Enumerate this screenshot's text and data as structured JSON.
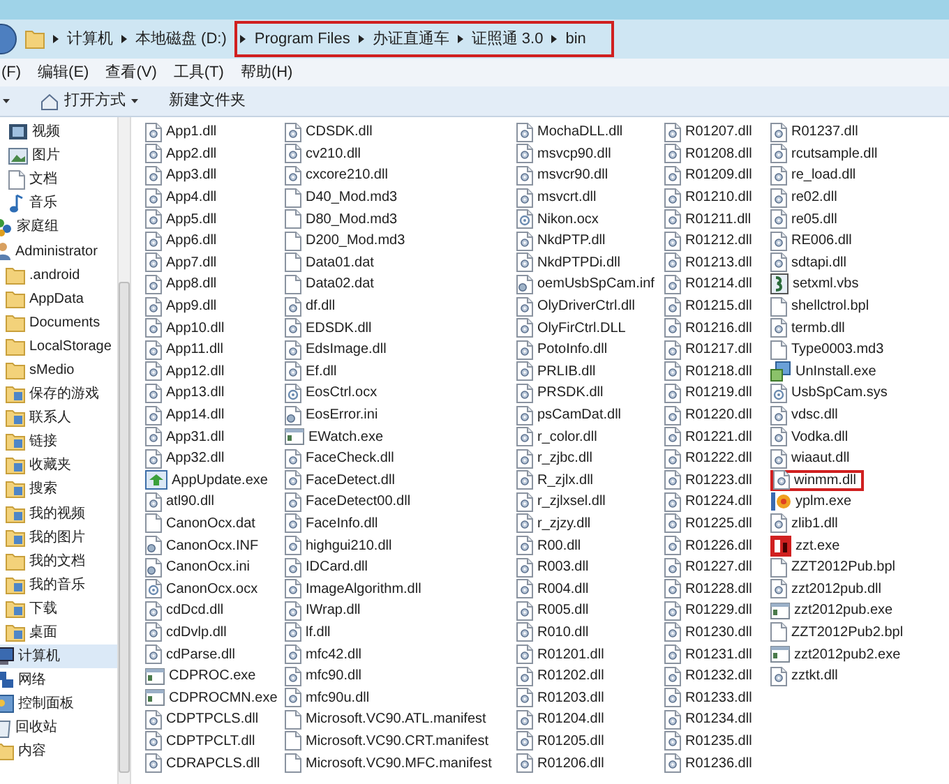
{
  "address": {
    "crumbs": [
      {
        "label": "计算机",
        "highlighted": false
      },
      {
        "label": "本地磁盘 (D:)",
        "highlighted": false
      },
      {
        "label": "Program Files",
        "highlighted": true
      },
      {
        "label": "办证直通车",
        "highlighted": true
      },
      {
        "label": "证照通 3.0",
        "highlighted": true
      },
      {
        "label": "bin",
        "highlighted": true
      }
    ]
  },
  "menu": [
    "(F)",
    "编辑(E)",
    "查看(V)",
    "工具(T)",
    "帮助(H)"
  ],
  "toolbar": [
    {
      "label": "打开方式",
      "kind": "open"
    },
    {
      "label": "新建文件夹",
      "kind": "plain"
    }
  ],
  "sidebar": {
    "library_items": [
      {
        "label": "视频",
        "kind": "video",
        "selected": false
      },
      {
        "label": "图片",
        "kind": "picture",
        "selected": false
      },
      {
        "label": "文档",
        "kind": "document",
        "selected": false
      },
      {
        "label": "音乐",
        "kind": "music",
        "selected": false
      }
    ],
    "items": [
      {
        "label": "家庭组",
        "kind": "homegroup",
        "selected": false
      },
      {
        "label": "Administrator",
        "kind": "user",
        "selected": false,
        "children": [
          {
            "label": ".android",
            "kind": "folder",
            "selected": false
          },
          {
            "label": "AppData",
            "kind": "folder",
            "selected": false
          },
          {
            "label": "Documents",
            "kind": "folder",
            "selected": false
          },
          {
            "label": "LocalStorage",
            "kind": "folder",
            "selected": false
          },
          {
            "label": "sMedio",
            "kind": "folder",
            "selected": false
          },
          {
            "label": "保存的游戏",
            "kind": "special",
            "selected": false
          },
          {
            "label": "联系人",
            "kind": "special",
            "selected": false
          },
          {
            "label": "链接",
            "kind": "special",
            "selected": false
          },
          {
            "label": "收藏夹",
            "kind": "special",
            "selected": false
          },
          {
            "label": "搜索",
            "kind": "special",
            "selected": false
          },
          {
            "label": "我的视频",
            "kind": "special",
            "selected": false
          },
          {
            "label": "我的图片",
            "kind": "special",
            "selected": false
          },
          {
            "label": "我的文档",
            "kind": "folder",
            "selected": false
          },
          {
            "label": "我的音乐",
            "kind": "special",
            "selected": false
          },
          {
            "label": "下载",
            "kind": "special",
            "selected": false
          },
          {
            "label": "桌面",
            "kind": "special",
            "selected": false
          }
        ]
      },
      {
        "label": "计算机",
        "kind": "computer",
        "selected": true
      },
      {
        "label": "网络",
        "kind": "network",
        "selected": false
      },
      {
        "label": "控制面板",
        "kind": "control",
        "selected": false
      },
      {
        "label": "回收站",
        "kind": "recycle",
        "selected": false
      },
      {
        "label": "内容",
        "kind": "folder",
        "selected": false
      }
    ]
  },
  "files": [
    {
      "name": "App1.dll",
      "kind": "dll",
      "highlighted": false
    },
    {
      "name": "App2.dll",
      "kind": "dll",
      "highlighted": false
    },
    {
      "name": "App3.dll",
      "kind": "dll",
      "highlighted": false
    },
    {
      "name": "App4.dll",
      "kind": "dll",
      "highlighted": false
    },
    {
      "name": "App5.dll",
      "kind": "dll",
      "highlighted": false
    },
    {
      "name": "App6.dll",
      "kind": "dll",
      "highlighted": false
    },
    {
      "name": "App7.dll",
      "kind": "dll",
      "highlighted": false
    },
    {
      "name": "App8.dll",
      "kind": "dll",
      "highlighted": false
    },
    {
      "name": "App9.dll",
      "kind": "dll",
      "highlighted": false
    },
    {
      "name": "App10.dll",
      "kind": "dll",
      "highlighted": false
    },
    {
      "name": "App11.dll",
      "kind": "dll",
      "highlighted": false
    },
    {
      "name": "App12.dll",
      "kind": "dll",
      "highlighted": false
    },
    {
      "name": "App13.dll",
      "kind": "dll",
      "highlighted": false
    },
    {
      "name": "App14.dll",
      "kind": "dll",
      "highlighted": false
    },
    {
      "name": "App31.dll",
      "kind": "dll",
      "highlighted": false
    },
    {
      "name": "App32.dll",
      "kind": "dll",
      "highlighted": false
    },
    {
      "name": "AppUpdate.exe",
      "kind": "update",
      "highlighted": false
    },
    {
      "name": "atl90.dll",
      "kind": "dll",
      "highlighted": false
    },
    {
      "name": "CanonOcx.dat",
      "kind": "file",
      "highlighted": false
    },
    {
      "name": "CanonOcx.INF",
      "kind": "config",
      "highlighted": false
    },
    {
      "name": "CanonOcx.ini",
      "kind": "config",
      "highlighted": false
    },
    {
      "name": "CanonOcx.ocx",
      "kind": "ocx",
      "highlighted": false
    },
    {
      "name": "cdDcd.dll",
      "kind": "dll",
      "highlighted": false
    },
    {
      "name": "cdDvlp.dll",
      "kind": "dll",
      "highlighted": false
    },
    {
      "name": "cdParse.dll",
      "kind": "dll",
      "highlighted": false
    },
    {
      "name": "CDPROC.exe",
      "kind": "exe",
      "highlighted": false
    },
    {
      "name": "CDPROCMN.exe",
      "kind": "exe",
      "highlighted": false
    },
    {
      "name": "CDPTPCLS.dll",
      "kind": "dll",
      "highlighted": false
    },
    {
      "name": "CDPTPCLT.dll",
      "kind": "dll",
      "highlighted": false
    },
    {
      "name": "CDRAPCLS.dll",
      "kind": "dll",
      "highlighted": false
    },
    {
      "name": "CDSDK.dll",
      "kind": "dll",
      "highlighted": false
    },
    {
      "name": "cv210.dll",
      "kind": "dll",
      "highlighted": false
    },
    {
      "name": "cxcore210.dll",
      "kind": "dll",
      "highlighted": false
    },
    {
      "name": "D40_Mod.md3",
      "kind": "file",
      "highlighted": false
    },
    {
      "name": "D80_Mod.md3",
      "kind": "file",
      "highlighted": false
    },
    {
      "name": "D200_Mod.md3",
      "kind": "file",
      "highlighted": false
    },
    {
      "name": "Data01.dat",
      "kind": "file",
      "highlighted": false
    },
    {
      "name": "Data02.dat",
      "kind": "file",
      "highlighted": false
    },
    {
      "name": "df.dll",
      "kind": "dll",
      "highlighted": false
    },
    {
      "name": "EDSDK.dll",
      "kind": "dll",
      "highlighted": false
    },
    {
      "name": "EdsImage.dll",
      "kind": "dll",
      "highlighted": false
    },
    {
      "name": "Ef.dll",
      "kind": "dll",
      "highlighted": false
    },
    {
      "name": "EosCtrl.ocx",
      "kind": "ocx",
      "highlighted": false
    },
    {
      "name": "EosError.ini",
      "kind": "config",
      "highlighted": false
    },
    {
      "name": "EWatch.exe",
      "kind": "exe",
      "highlighted": false
    },
    {
      "name": "FaceCheck.dll",
      "kind": "dll",
      "highlighted": false
    },
    {
      "name": "FaceDetect.dll",
      "kind": "dll",
      "highlighted": false
    },
    {
      "name": "FaceDetect00.dll",
      "kind": "dll",
      "highlighted": false
    },
    {
      "name": "FaceInfo.dll",
      "kind": "dll",
      "highlighted": false
    },
    {
      "name": "highgui210.dll",
      "kind": "dll",
      "highlighted": false
    },
    {
      "name": "IDCard.dll",
      "kind": "dll",
      "highlighted": false
    },
    {
      "name": "ImageAlgorithm.dll",
      "kind": "dll",
      "highlighted": false
    },
    {
      "name": "IWrap.dll",
      "kind": "dll",
      "highlighted": false
    },
    {
      "name": "lf.dll",
      "kind": "dll",
      "highlighted": false
    },
    {
      "name": "mfc42.dll",
      "kind": "dll",
      "highlighted": false
    },
    {
      "name": "mfc90.dll",
      "kind": "dll",
      "highlighted": false
    },
    {
      "name": "mfc90u.dll",
      "kind": "dll",
      "highlighted": false
    },
    {
      "name": "Microsoft.VC90.ATL.manifest",
      "kind": "file",
      "highlighted": false
    },
    {
      "name": "Microsoft.VC90.CRT.manifest",
      "kind": "file",
      "highlighted": false
    },
    {
      "name": "Microsoft.VC90.MFC.manifest",
      "kind": "file",
      "highlighted": false
    },
    {
      "name": "MochaDLL.dll",
      "kind": "dll",
      "highlighted": false
    },
    {
      "name": "msvcp90.dll",
      "kind": "dll",
      "highlighted": false
    },
    {
      "name": "msvcr90.dll",
      "kind": "dll",
      "highlighted": false
    },
    {
      "name": "msvcrt.dll",
      "kind": "dll",
      "highlighted": false
    },
    {
      "name": "Nikon.ocx",
      "kind": "ocx",
      "highlighted": false
    },
    {
      "name": "NkdPTP.dll",
      "kind": "dll",
      "highlighted": false
    },
    {
      "name": "NkdPTPDi.dll",
      "kind": "dll",
      "highlighted": false
    },
    {
      "name": "oemUsbSpCam.inf",
      "kind": "config",
      "highlighted": false
    },
    {
      "name": "OlyDriverCtrl.dll",
      "kind": "dll",
      "highlighted": false
    },
    {
      "name": "OlyFirCtrl.DLL",
      "kind": "dll",
      "highlighted": false
    },
    {
      "name": "PotoInfo.dll",
      "kind": "dll",
      "highlighted": false
    },
    {
      "name": "PRLIB.dll",
      "kind": "dll",
      "highlighted": false
    },
    {
      "name": "PRSDK.dll",
      "kind": "dll",
      "highlighted": false
    },
    {
      "name": "psCamDat.dll",
      "kind": "dll",
      "highlighted": false
    },
    {
      "name": "r_color.dll",
      "kind": "dll",
      "highlighted": false
    },
    {
      "name": "r_zjbc.dll",
      "kind": "dll",
      "highlighted": false
    },
    {
      "name": "R_zjlx.dll",
      "kind": "dll",
      "highlighted": false
    },
    {
      "name": "r_zjlxsel.dll",
      "kind": "dll",
      "highlighted": false
    },
    {
      "name": "r_zjzy.dll",
      "kind": "dll",
      "highlighted": false
    },
    {
      "name": "R00.dll",
      "kind": "dll",
      "highlighted": false
    },
    {
      "name": "R003.dll",
      "kind": "dll",
      "highlighted": false
    },
    {
      "name": "R004.dll",
      "kind": "dll",
      "highlighted": false
    },
    {
      "name": "R005.dll",
      "kind": "dll",
      "highlighted": false
    },
    {
      "name": "R010.dll",
      "kind": "dll",
      "highlighted": false
    },
    {
      "name": "R01201.dll",
      "kind": "dll",
      "highlighted": false
    },
    {
      "name": "R01202.dll",
      "kind": "dll",
      "highlighted": false
    },
    {
      "name": "R01203.dll",
      "kind": "dll",
      "highlighted": false
    },
    {
      "name": "R01204.dll",
      "kind": "dll",
      "highlighted": false
    },
    {
      "name": "R01205.dll",
      "kind": "dll",
      "highlighted": false
    },
    {
      "name": "R01206.dll",
      "kind": "dll",
      "highlighted": false
    },
    {
      "name": "R01207.dll",
      "kind": "dll",
      "highlighted": false
    },
    {
      "name": "R01208.dll",
      "kind": "dll",
      "highlighted": false
    },
    {
      "name": "R01209.dll",
      "kind": "dll",
      "highlighted": false
    },
    {
      "name": "R01210.dll",
      "kind": "dll",
      "highlighted": false
    },
    {
      "name": "R01211.dll",
      "kind": "dll",
      "highlighted": false
    },
    {
      "name": "R01212.dll",
      "kind": "dll",
      "highlighted": false
    },
    {
      "name": "R01213.dll",
      "kind": "dll",
      "highlighted": false
    },
    {
      "name": "R01214.dll",
      "kind": "dll",
      "highlighted": false
    },
    {
      "name": "R01215.dll",
      "kind": "dll",
      "highlighted": false
    },
    {
      "name": "R01216.dll",
      "kind": "dll",
      "highlighted": false
    },
    {
      "name": "R01217.dll",
      "kind": "dll",
      "highlighted": false
    },
    {
      "name": "R01218.dll",
      "kind": "dll",
      "highlighted": false
    },
    {
      "name": "R01219.dll",
      "kind": "dll",
      "highlighted": false
    },
    {
      "name": "R01220.dll",
      "kind": "dll",
      "highlighted": false
    },
    {
      "name": "R01221.dll",
      "kind": "dll",
      "highlighted": false
    },
    {
      "name": "R01222.dll",
      "kind": "dll",
      "highlighted": false
    },
    {
      "name": "R01223.dll",
      "kind": "dll",
      "highlighted": false
    },
    {
      "name": "R01224.dll",
      "kind": "dll",
      "highlighted": false
    },
    {
      "name": "R01225.dll",
      "kind": "dll",
      "highlighted": false
    },
    {
      "name": "R01226.dll",
      "kind": "dll",
      "highlighted": false
    },
    {
      "name": "R01227.dll",
      "kind": "dll",
      "highlighted": false
    },
    {
      "name": "R01228.dll",
      "kind": "dll",
      "highlighted": false
    },
    {
      "name": "R01229.dll",
      "kind": "dll",
      "highlighted": false
    },
    {
      "name": "R01230.dll",
      "kind": "dll",
      "highlighted": false
    },
    {
      "name": "R01231.dll",
      "kind": "dll",
      "highlighted": false
    },
    {
      "name": "R01232.dll",
      "kind": "dll",
      "highlighted": false
    },
    {
      "name": "R01233.dll",
      "kind": "dll",
      "highlighted": false
    },
    {
      "name": "R01234.dll",
      "kind": "dll",
      "highlighted": false
    },
    {
      "name": "R01235.dll",
      "kind": "dll",
      "highlighted": false
    },
    {
      "name": "R01236.dll",
      "kind": "dll",
      "highlighted": false
    },
    {
      "name": "R01237.dll",
      "kind": "dll",
      "highlighted": false
    },
    {
      "name": "rcutsample.dll",
      "kind": "dll",
      "highlighted": false
    },
    {
      "name": "re_load.dll",
      "kind": "dll",
      "highlighted": false
    },
    {
      "name": "re02.dll",
      "kind": "dll",
      "highlighted": false
    },
    {
      "name": "re05.dll",
      "kind": "dll",
      "highlighted": false
    },
    {
      "name": "RE006.dll",
      "kind": "dll",
      "highlighted": false
    },
    {
      "name": "sdtapi.dll",
      "kind": "dll",
      "highlighted": false
    },
    {
      "name": "setxml.vbs",
      "kind": "script",
      "highlighted": false
    },
    {
      "name": "shellctrol.bpl",
      "kind": "file",
      "highlighted": false
    },
    {
      "name": "termb.dll",
      "kind": "dll",
      "highlighted": false
    },
    {
      "name": "Type0003.md3",
      "kind": "file",
      "highlighted": false
    },
    {
      "name": "UnInstall.exe",
      "kind": "installer",
      "highlighted": false
    },
    {
      "name": "UsbSpCam.sys",
      "kind": "ocx",
      "highlighted": false
    },
    {
      "name": "vdsc.dll",
      "kind": "dll",
      "highlighted": false
    },
    {
      "name": "Vodka.dll",
      "kind": "dll",
      "highlighted": false
    },
    {
      "name": "wiaaut.dll",
      "kind": "dll",
      "highlighted": false
    },
    {
      "name": "winmm.dll",
      "kind": "dll",
      "highlighted": true
    },
    {
      "name": "yplm.exe",
      "kind": "media",
      "highlighted": false
    },
    {
      "name": "zlib1.dll",
      "kind": "dll",
      "highlighted": false
    },
    {
      "name": "zzt.exe",
      "kind": "red",
      "highlighted": false
    },
    {
      "name": "ZZT2012Pub.bpl",
      "kind": "file",
      "highlighted": false
    },
    {
      "name": "zzt2012pub.dll",
      "kind": "dll",
      "highlighted": false
    },
    {
      "name": "zzt2012pub.exe",
      "kind": "exe",
      "highlighted": false
    },
    {
      "name": "ZZT2012Pub2.bpl",
      "kind": "file",
      "highlighted": false
    },
    {
      "name": "zzt2012pub2.exe",
      "kind": "exe",
      "highlighted": false
    },
    {
      "name": "zztkt.dll",
      "kind": "dll",
      "highlighted": false
    }
  ]
}
